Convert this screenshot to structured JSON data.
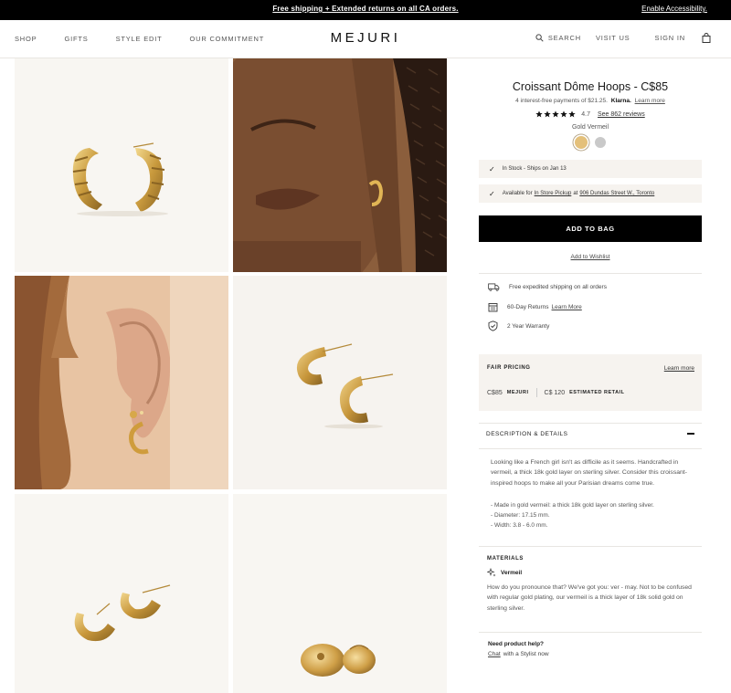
{
  "announcement": {
    "promo": "Free shipping + Extended returns on all CA orders.",
    "accessibility": "Enable Accessibility."
  },
  "header": {
    "logo": "MEJURI",
    "nav_left": [
      "SHOP",
      "GIFTS",
      "STYLE EDIT",
      "OUR COMMITMENT"
    ],
    "search": "SEARCH",
    "visit": "VISIT US",
    "signin": "SIGN IN"
  },
  "product": {
    "title": "Croissant Dôme Hoops - C$85",
    "klarna_prefix": "4 interest-free payments of $21.25.",
    "klarna_brand": "Klarna.",
    "klarna_learn": "Learn more",
    "rating_value": "4.7",
    "rating_out_of": 5,
    "reviews": "See 862 reviews",
    "metal_label": "Gold Vermeil",
    "swatches": [
      "gold",
      "silver"
    ],
    "stock": "In Stock - Ships on Jan 13",
    "pickup_prefix": "Available for",
    "pickup_link": "In Store Pickup",
    "pickup_at": "at",
    "pickup_address": "906 Dundas Street W., Toronto",
    "add_to_bag": "ADD TO BAG",
    "wishlist": "Add to Wishlist"
  },
  "perks": {
    "shipping": "Free expedited shipping on all orders",
    "returns": "60-Day Returns",
    "returns_link": "Learn More",
    "warranty": "2 Year Warranty"
  },
  "fair_pricing": {
    "title": "FAIR PRICING",
    "learn": "Learn more",
    "our_price": "C$85",
    "our_label": "MEJURI",
    "retail_price": "C$ 120",
    "retail_label": "ESTIMATED RETAIL"
  },
  "description": {
    "heading": "DESCRIPTION & DETAILS",
    "body": "Looking like a French girl isn't as difficile as it seems. Handcrafted in vermeil, a thick 18k gold layer on sterling silver. Consider this croissant-inspired hoops to make all your Parisian dreams come true.",
    "details": [
      "- Made in gold vermeil: a thick 18k gold layer on sterling silver.",
      "- Diameter: 17.15 mm.",
      "- Width: 3.8 - 6.0 mm."
    ]
  },
  "materials": {
    "heading": "MATERIALS",
    "sub": "Vermeil",
    "body": "How do you pronounce that? We've got you: ver - may. Not to be confused with regular gold plating, our vermeil is a thick layer of 18k solid gold on sterling silver."
  },
  "help": {
    "heading": "Need product help?",
    "chat_link": "Chat",
    "chat_rest": "with a Stylist now"
  },
  "colors": {
    "accent_black": "#000000",
    "panel_bg": "#f6f3ef",
    "gold": "#e4c07a",
    "silver": "#c9c9c9"
  }
}
